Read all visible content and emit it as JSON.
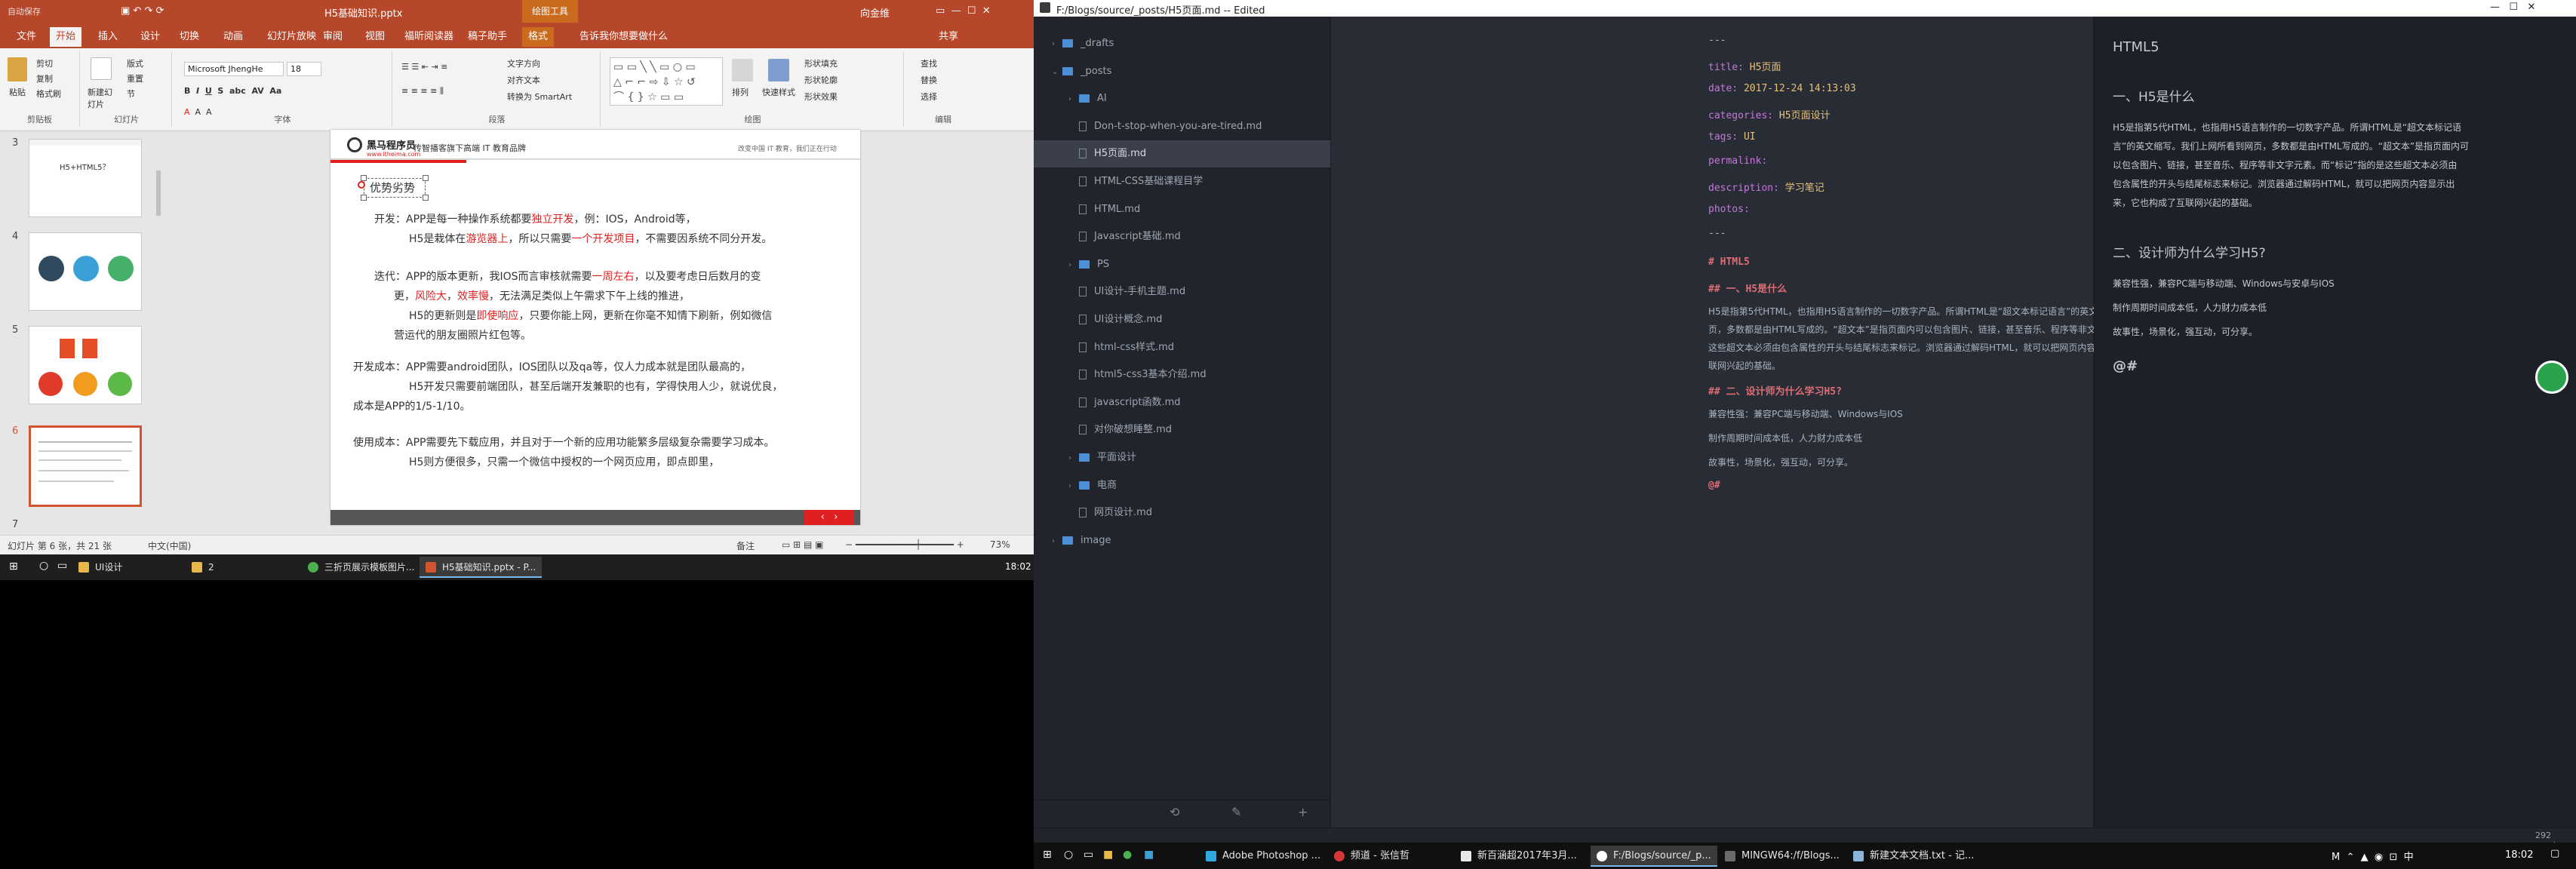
{
  "ppt": {
    "title_left": "自动保存",
    "file_title": "H5基础知识.pptx",
    "context_tab": "绘图工具",
    "user": "向金维",
    "tabs": [
      "文件",
      "开始",
      "插入",
      "设计",
      "切换",
      "动画",
      "幻灯片放映",
      "审阅",
      "视图",
      "福昕阅读器",
      "稿子助手",
      "格式"
    ],
    "active_tab": "开始",
    "tell_me": "告诉我你想要做什么",
    "share": "共享",
    "ribbon": {
      "clipboard": {
        "paste": "粘贴",
        "cut": "剪切",
        "copy": "复制",
        "format_painter": "格式刷",
        "caption": "剪贴板"
      },
      "slides": {
        "new": "新建幻灯片",
        "layout": "版式",
        "reset": "重置",
        "section": "节",
        "caption": "幻灯片"
      },
      "font": {
        "name": "Microsoft JhengHe",
        "size": "18",
        "caption": "字体"
      },
      "paragraph": {
        "text_dir": "文字方向",
        "align_text": "对齐文本",
        "smartart": "转换为 SmartArt",
        "caption": "段落"
      },
      "drawing": {
        "arrange": "排列",
        "quick_styles": "快速样式",
        "fill": "形状填充",
        "outline": "形状轮廓",
        "effects": "形状效果",
        "caption": "绘图"
      },
      "editing": {
        "find": "查找",
        "replace": "替换",
        "select": "选择",
        "caption": "编辑"
      }
    },
    "thumbnails": [
      {
        "num": "3",
        "title": "H5+HTML5？"
      },
      {
        "num": "4",
        "title": ""
      },
      {
        "num": "5",
        "title": ""
      },
      {
        "num": "6",
        "title": ""
      },
      {
        "num": "7",
        "title": ""
      }
    ],
    "slide": {
      "logo_text": "黑马程序员",
      "header_text": "传智播客旗下高端 IT 教育品牌",
      "header_right": "改变中国 IT 教育，我们正在行动",
      "logo_url": "www.itheima.com",
      "subtitle": "优势劣势",
      "lines": [
        {
          "pre": "开发：APP是每一种操作系统都要",
          "red": "独立开发",
          "post": "，例：IOS，Android等，"
        },
        {
          "pre": "H5是栽体在",
          "red": "游览器上",
          "post": "，所以只需要",
          "red2": "一个开发项目",
          "post2": "，不需要因系统不同分开发。"
        },
        {
          "pre": "迭代：APP的版本更新，我IOS而言审核就需要",
          "red": "一周左右",
          "post": "，以及要考虑日后数月的变"
        },
        {
          "pre": "更，",
          "red": "风险大",
          "post": "，",
          "red2": "效率慢",
          "post2": "，无法满足类似上午需求下午上线的推进，"
        },
        {
          "pre": "H5的更新则是",
          "red": "即使响应",
          "post": "，只要你能上网，更新在你毫不知情下刷新，例如微信"
        },
        {
          "pre": "营运代的朋友圈照片红包等。",
          "red": "",
          "post": ""
        },
        {
          "pre": "开发成本：APP需要android团队，IOS团队以及qa等，仅人力成本就是团队最高的，",
          "red": "",
          "post": ""
        },
        {
          "pre": "H5开发只需要前端团队，甚至后端开发兼职的也有，学得快用人少，就说优良，",
          "red": "",
          "post": ""
        },
        {
          "pre": "成本是APP的1/5-1/10。",
          "red": "",
          "post": ""
        },
        {
          "pre": "使用成本：APP需要先下载应用，并且对于一个新的应用功能繁多层级复杂需要学习成本。",
          "red": "",
          "post": ""
        },
        {
          "pre": "H5则方便很多，只需一个微信中授权的一个网页应用，即点即里，",
          "red": "",
          "post": ""
        }
      ]
    },
    "status": {
      "slide_info": "幻灯片 第 6 张，共 21 张",
      "lang": "中文(中国)",
      "notes": "备注",
      "zoom": "73%"
    }
  },
  "taskbar_left": {
    "items": [
      "UI设计",
      "2",
      "三折页展示模板图片...",
      "H5基础知识.pptx - P..."
    ],
    "time": "18:02"
  },
  "editor": {
    "title": "F:/Blogs/source/_posts/H5页面.md -- Edited",
    "tree": [
      {
        "type": "folder",
        "label": "_drafts",
        "indent": 0,
        "chev": "›"
      },
      {
        "type": "folder",
        "label": "_posts",
        "indent": 0,
        "chev": "⌄"
      },
      {
        "type": "folder",
        "label": "AI",
        "indent": 1,
        "chev": "›"
      },
      {
        "type": "file",
        "label": "Don-t-stop-when-you-are-tired.md",
        "indent": 1,
        "chev": ""
      },
      {
        "type": "file",
        "label": "H5页面.md",
        "indent": 1,
        "chev": "",
        "selected": true
      },
      {
        "type": "file",
        "label": "HTML-CSS基础课程目学",
        "indent": 1,
        "chev": ""
      },
      {
        "type": "file",
        "label": "HTML.md",
        "indent": 1,
        "chev": ""
      },
      {
        "type": "file",
        "label": "Javascript基础.md",
        "indent": 1,
        "chev": ""
      },
      {
        "type": "folder",
        "label": "PS",
        "indent": 1,
        "chev": "›"
      },
      {
        "type": "file",
        "label": "UI设计-手机主题.md",
        "indent": 1,
        "chev": ""
      },
      {
        "type": "file",
        "label": "UI设计概念.md",
        "indent": 1,
        "chev": ""
      },
      {
        "type": "file",
        "label": "html-css样式.md",
        "indent": 1,
        "chev": ""
      },
      {
        "type": "file",
        "label": "html5-css3基本介绍.md",
        "indent": 1,
        "chev": ""
      },
      {
        "type": "file",
        "label": "javascript函数.md",
        "indent": 1,
        "chev": ""
      },
      {
        "type": "file",
        "label": "对你破想睡整.md",
        "indent": 1,
        "chev": ""
      },
      {
        "type": "folder",
        "label": "平面设计",
        "indent": 1,
        "chev": "›"
      },
      {
        "type": "folder",
        "label": "电商",
        "indent": 1,
        "chev": "›"
      },
      {
        "type": "file",
        "label": "网页设计.md",
        "indent": 1,
        "chev": ""
      },
      {
        "type": "folder",
        "label": "image",
        "indent": 0,
        "chev": "›"
      }
    ],
    "source": {
      "front_matter": [
        {
          "key": "",
          "val": "---"
        },
        {
          "key": "title:",
          "val": "H5页面"
        },
        {
          "key": "date:",
          "val": "2017-12-24 14:13:03"
        },
        {
          "key": "categories:",
          "val": "H5页面设计"
        },
        {
          "key": "tags:",
          "val": "UI"
        },
        {
          "key": "permalink:",
          "val": ""
        },
        {
          "key": "description:",
          "val": "学习笔记"
        },
        {
          "key": "photos:",
          "val": ""
        },
        {
          "key": "",
          "val": "---"
        }
      ],
      "h1": "# HTML5",
      "h2a": "## 一、H5是什么",
      "para1": [
        "H5是指第5代HTML，也指用H5语言制作的一切数字产品。所谓HTML是“超文本标记语言”的英文缩写。我们上网所看到网",
        "页，多数都是由HTML写成的。“超文本”是指页面内可以包含图片、链接，甚至音乐、程序等非文字元素。而“标记”指的是",
        "这些超文本必须由包含属性的开头与结尾标志来标记。浏览器通过解码HTML，就可以把网页内容显示出来，它也构成了互",
        "联网兴起的基础。"
      ],
      "h2b": "## 二、设计师为什么学习H5?",
      "list": [
        "兼容性强：兼容PC端与移动端、Windows与IOS",
        "制作周期时间成本低，人力财力成本低",
        "故事性，场景化，强互动，可分享。"
      ],
      "cursor_line": "@#"
    },
    "preview": {
      "h1": "HTML5",
      "h2a": "一、H5是什么",
      "para1": [
        "H5是指第5代HTML，也指用H5语言制作的一切数字产品。所谓HTML是“超文本标记语",
        "言”的英文缩写。我们上网所看到网页，多数都是由HTML写成的。“超文本”是指页面内可",
        "以包含图片、链接，甚至音乐、程序等非文字元素。而“标记”指的是这些超文本必须由",
        "包含属性的开头与结尾标志来标记。浏览器通过解码HTML，就可以把网页内容显示出",
        "来，它也构成了互联网兴起的基础。"
      ],
      "h2b": "二、设计师为什么学习H5?",
      "list": [
        "兼容性强，兼容PC端与移动端、Windows与安卓与IOS",
        "制作周期时间成本低，人力财力成本低",
        "故事性，场景化，强互动，可分享。"
      ],
      "cursor": "@#"
    },
    "status": {
      "left": "",
      "right": "292 words"
    }
  },
  "taskbar_right": {
    "items": [
      "Adobe Photoshop ...",
      "频道 - 张信哲",
      "新百涵超2017年3月...",
      "F:/Blogs/source/_p...",
      "MINGW64:/f/Blogs...",
      "新建文本文档.txt - 记..."
    ],
    "time": "18:02"
  },
  "colors": {
    "ppt_accent": "#b7472a",
    "slide_red": "#e02020",
    "editor_bg": "#282c34",
    "sidebar_bg": "#21252b",
    "selection": "#3a3f4b"
  }
}
